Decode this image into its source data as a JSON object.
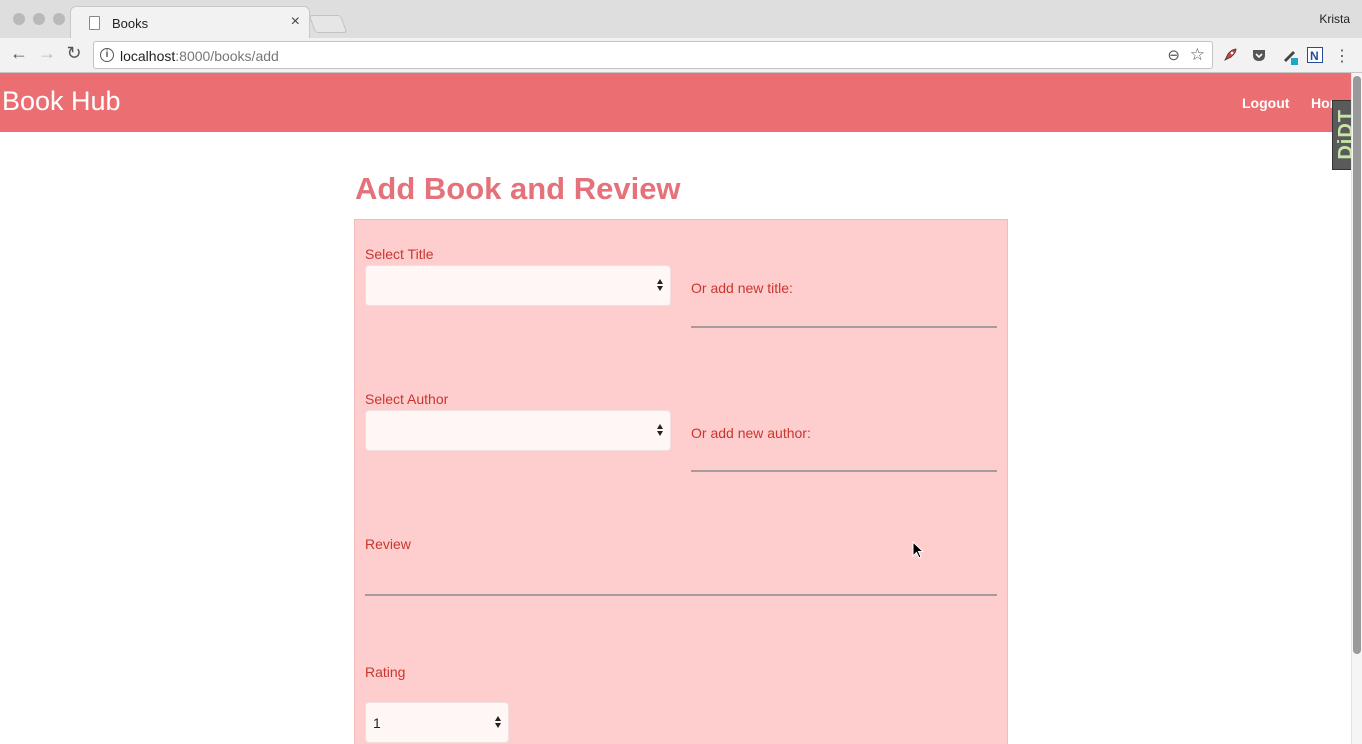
{
  "browser": {
    "tab_title": "Books",
    "tab_close": "×",
    "profile_name": "Krista",
    "url_host": "localhost",
    "url_path": ":8000/books/add",
    "back_icon": "←",
    "forward_icon": "→",
    "reload_icon": "↻",
    "info_icon": "i",
    "zoom_icon": "⊖",
    "star_icon": "☆",
    "menu_icon": "⋮"
  },
  "navbar": {
    "brand": "Book Hub",
    "links": [
      "Logout",
      "Home"
    ]
  },
  "debug_toolbar": {
    "label": "DjDT"
  },
  "page": {
    "heading": "Add Book and Review"
  },
  "form": {
    "title_label": "Select Title",
    "title_value": "",
    "new_title_label": "Or add new title:",
    "author_label": "Select Author",
    "author_value": "",
    "new_author_label": "Or add new author:",
    "review_label": "Review",
    "rating_label": "Rating",
    "rating_value": "1"
  },
  "colors": {
    "navbar": "#eb6f72",
    "heading": "#e5727a",
    "form_background": "#fecdce",
    "label": "#c8372f"
  }
}
